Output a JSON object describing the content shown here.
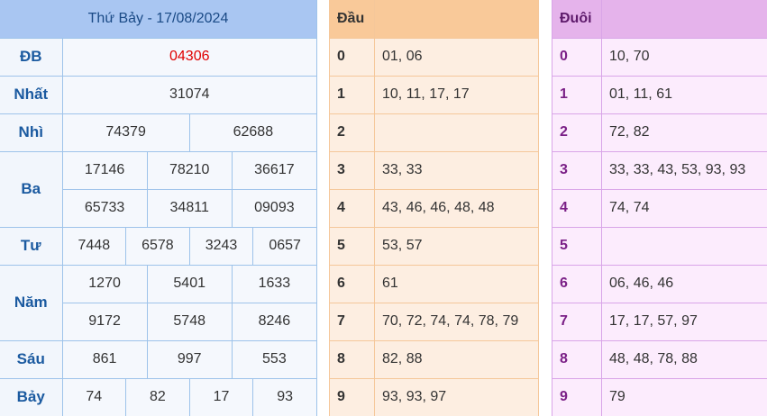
{
  "results": {
    "title": "Thứ Bảy - 17/08/2024",
    "prizes": {
      "db": {
        "name": "ĐB",
        "numbers": [
          "04306"
        ]
      },
      "nhat": {
        "name": "Nhất",
        "numbers": [
          "31074"
        ]
      },
      "nhi": {
        "name": "Nhì",
        "numbers": [
          "74379",
          "62688"
        ]
      },
      "ba": {
        "name": "Ba",
        "numbers": [
          "17146",
          "78210",
          "36617",
          "65733",
          "34811",
          "09093"
        ]
      },
      "tu": {
        "name": "Tư",
        "numbers": [
          "7448",
          "6578",
          "3243",
          "0657"
        ]
      },
      "nam": {
        "name": "Năm",
        "numbers": [
          "1270",
          "5401",
          "1633",
          "9172",
          "5748",
          "8246"
        ]
      },
      "sau": {
        "name": "Sáu",
        "numbers": [
          "861",
          "997",
          "553"
        ]
      },
      "bay": {
        "name": "Bảy",
        "numbers": [
          "74",
          "82",
          "17",
          "93"
        ]
      }
    },
    "special_color": "#e00000"
  },
  "dau": {
    "header": "Đầu",
    "rows": [
      {
        "key": "0",
        "values": "01, 06"
      },
      {
        "key": "1",
        "values": "10, 11, 17, 17"
      },
      {
        "key": "2",
        "values": ""
      },
      {
        "key": "3",
        "values": "33, 33"
      },
      {
        "key": "4",
        "values": "43, 46, 46, 48, 48"
      },
      {
        "key": "5",
        "values": "53, 57"
      },
      {
        "key": "6",
        "values": "61"
      },
      {
        "key": "7",
        "values": "70, 72, 74, 74, 78, 79"
      },
      {
        "key": "8",
        "values": "82, 88"
      },
      {
        "key": "9",
        "values": "93, 93, 97"
      }
    ]
  },
  "duoi": {
    "header": "Đuôi",
    "rows": [
      {
        "key": "0",
        "values": "10, 70"
      },
      {
        "key": "1",
        "values": "01, 11, 61"
      },
      {
        "key": "2",
        "values": "72, 82"
      },
      {
        "key": "3",
        "values": "33, 33, 43, 53, 93, 93"
      },
      {
        "key": "4",
        "values": "74, 74"
      },
      {
        "key": "5",
        "values": ""
      },
      {
        "key": "6",
        "values": "06, 46, 46"
      },
      {
        "key": "7",
        "values": "17, 17, 57, 97"
      },
      {
        "key": "8",
        "values": "48, 48, 78, 88"
      },
      {
        "key": "9",
        "values": "79"
      }
    ]
  }
}
